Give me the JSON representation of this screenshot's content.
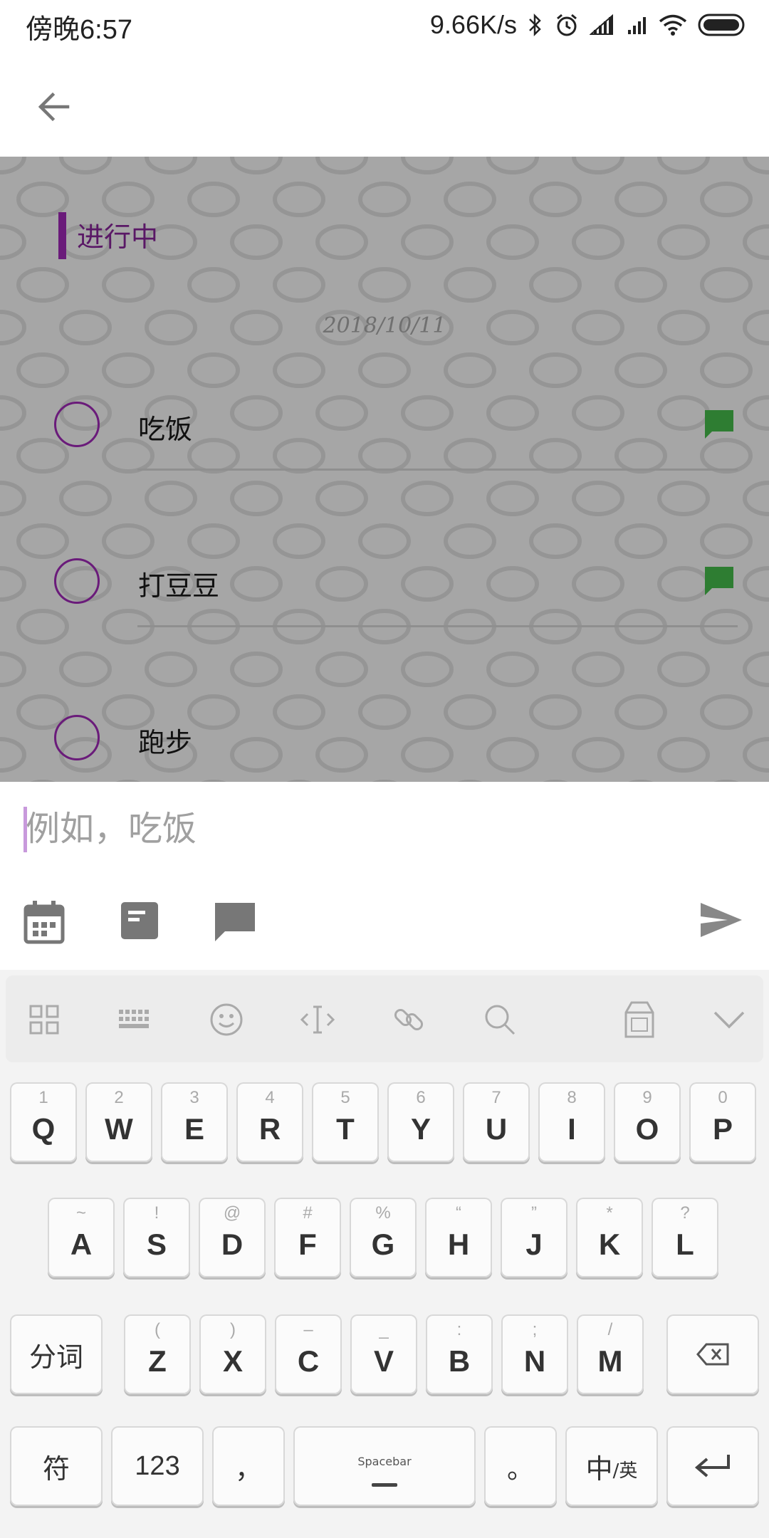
{
  "status_bar": {
    "time": "傍晚6:57",
    "network_speed": "9.66K/s",
    "icons": [
      "bluetooth-icon",
      "alarm-icon",
      "signal-icon",
      "signal-icon",
      "wifi-icon",
      "battery-icon"
    ]
  },
  "app_bar": {
    "back_icon": "arrow-left-icon"
  },
  "section": {
    "title": "进行中",
    "accent": "#6a1b7a"
  },
  "date": "2018/10/11",
  "tasks": [
    {
      "label": "吃饭",
      "has_comment": true
    },
    {
      "label": "打豆豆",
      "has_comment": true
    },
    {
      "label": "跑步",
      "has_comment": false
    }
  ],
  "input": {
    "placeholder": "例如，吃饭",
    "value": ""
  },
  "tools": [
    "calendar-icon",
    "note-icon",
    "comment-icon"
  ],
  "send_icon": "send-icon",
  "keyboard": {
    "toolbar": [
      "grid-icon",
      "keyboard-icon",
      "emoji-icon",
      "text-cursor-icon",
      "link-icon",
      "search-icon",
      "milk-box-icon",
      "chevron-down-icon"
    ],
    "row1": [
      {
        "k": "Q",
        "s": "1"
      },
      {
        "k": "W",
        "s": "2"
      },
      {
        "k": "E",
        "s": "3"
      },
      {
        "k": "R",
        "s": "4"
      },
      {
        "k": "T",
        "s": "5"
      },
      {
        "k": "Y",
        "s": "6"
      },
      {
        "k": "U",
        "s": "7"
      },
      {
        "k": "I",
        "s": "8"
      },
      {
        "k": "O",
        "s": "9"
      },
      {
        "k": "P",
        "s": "0"
      }
    ],
    "row2": [
      {
        "k": "A",
        "s": "~"
      },
      {
        "k": "S",
        "s": "!"
      },
      {
        "k": "D",
        "s": "@"
      },
      {
        "k": "F",
        "s": "#"
      },
      {
        "k": "G",
        "s": "%"
      },
      {
        "k": "H",
        "s": "“"
      },
      {
        "k": "J",
        "s": "”"
      },
      {
        "k": "K",
        "s": "*"
      },
      {
        "k": "L",
        "s": "?"
      }
    ],
    "row3": [
      {
        "k": "Z",
        "s": "("
      },
      {
        "k": "X",
        "s": ")"
      },
      {
        "k": "C",
        "s": "–"
      },
      {
        "k": "V",
        "s": "_"
      },
      {
        "k": "B",
        "s": ":"
      },
      {
        "k": "N",
        "s": ";"
      },
      {
        "k": "M",
        "s": "/"
      }
    ],
    "fenci": "分词",
    "fu": "符",
    "num": "123",
    "comma": "，",
    "space": "Spacebar",
    "period": "。",
    "lang_main": "中",
    "lang_sub": "/英"
  }
}
